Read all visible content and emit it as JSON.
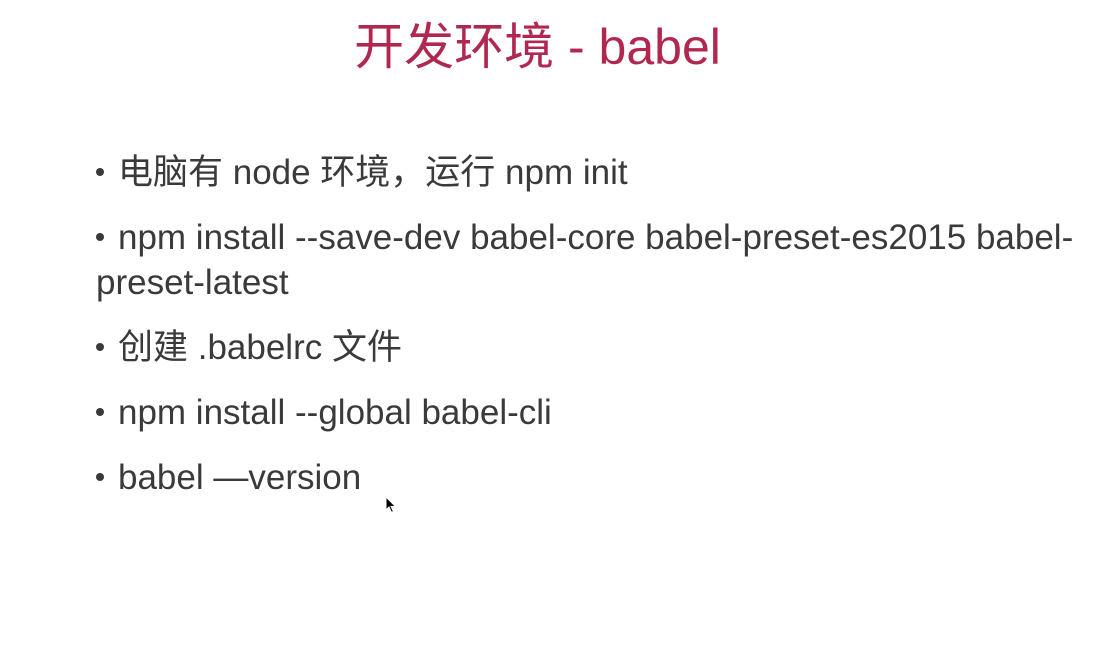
{
  "slide": {
    "title": "开发环境 - babel",
    "title_color": "#b02850",
    "text_color": "#3a3a3a",
    "bullets": [
      {
        "text": "电脑有 node 环境，运行 npm init"
      },
      {
        "text": "npm install --save-dev babel-core babel-preset-es2015 babel-preset-latest"
      },
      {
        "text": "创建 .babelrc 文件"
      },
      {
        "text": "npm install --global babel-cli"
      },
      {
        "text": "babel —version"
      }
    ]
  },
  "cursor": {
    "icon": "mouse-pointer-icon"
  }
}
